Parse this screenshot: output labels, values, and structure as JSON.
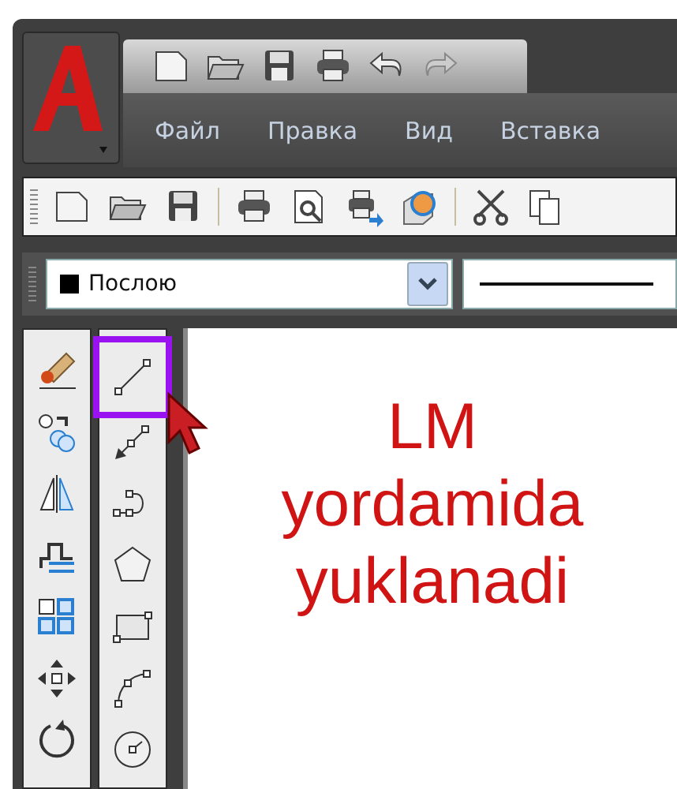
{
  "menu": [
    {
      "label": "Файл"
    },
    {
      "label": "Правка"
    },
    {
      "label": "Вид"
    },
    {
      "label": "Вставка"
    }
  ],
  "layer_combo": {
    "value": "Послою"
  },
  "modify_tools": [
    {
      "kind": "erase"
    },
    {
      "kind": "copy"
    },
    {
      "kind": "mirror"
    },
    {
      "kind": "offset"
    },
    {
      "kind": "array"
    },
    {
      "kind": "move"
    },
    {
      "kind": "rotate"
    }
  ],
  "draw_tools": [
    {
      "kind": "line",
      "highlighted": true
    },
    {
      "kind": "ray",
      "highlighted": false
    },
    {
      "kind": "polyline",
      "highlighted": false
    },
    {
      "kind": "polygon",
      "highlighted": false
    },
    {
      "kind": "rectangle",
      "highlighted": false
    },
    {
      "kind": "arc",
      "highlighted": false
    },
    {
      "kind": "circle",
      "highlighted": false
    }
  ],
  "canvas": {
    "caption_lines": [
      "LM",
      "yordamida",
      "yuklanadi"
    ]
  }
}
